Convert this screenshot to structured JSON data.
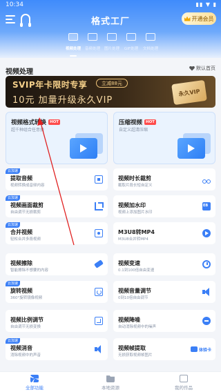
{
  "status": {
    "time": "10:34",
    "sys": "▮▮ ▼ ▮"
  },
  "header": {
    "title": "格式工厂",
    "vip_label": "开通会员"
  },
  "categories": [
    {
      "label": "视频处理",
      "active": true
    },
    {
      "label": "音频处理",
      "active": false
    },
    {
      "label": "图片处理",
      "active": false
    },
    {
      "label": "GIF处理",
      "active": false
    },
    {
      "label": "文档处理",
      "active": false
    }
  ],
  "section": {
    "title": "视频处理",
    "pin_label": "默认首页"
  },
  "banner": {
    "line1": "SVIP年卡限时专享",
    "button": "立减88元",
    "line2": "10元 加量升级永久VIP",
    "badge": "永久VIP"
  },
  "big_cards": [
    {
      "title": "视频格式转换",
      "hot": "HOT",
      "desc": "超千种组合任意换"
    },
    {
      "title": "压缩视频",
      "hot": "HOT",
      "desc": "自定义超清压缩"
    }
  ],
  "tag_label": "云加速",
  "items": [
    {
      "title": "提取音频",
      "desc": "视频转换成音频内容",
      "tag": true,
      "icon": "document-icon"
    },
    {
      "title": "视频时长裁剪",
      "desc": "截取片段长短自定义",
      "tag": false,
      "icon": "scissors-icon"
    },
    {
      "title": "视频画面裁剪",
      "desc": "自由调节无损裁剪",
      "tag": true,
      "icon": "crop-icon"
    },
    {
      "title": "视频加水印",
      "desc": "视频上添加图片水印",
      "tag": false,
      "icon": "watermark-icon"
    },
    {
      "title": "合并视频",
      "desc": "轻松合并多段视频",
      "tag": true,
      "icon": "merge-icon"
    },
    {
      "title": "M3U8转MP4",
      "desc": "M3U8合并转MP4",
      "tag": false,
      "icon": "play-icon"
    },
    {
      "title": "视频擦除",
      "desc": "智能擦除不想要的内容",
      "tag": false,
      "icon": "eraser-icon"
    },
    {
      "title": "视频变速",
      "desc": "0.1到100倍自由变速",
      "tag": false,
      "icon": "speed-icon"
    },
    {
      "title": "旋转视频",
      "desc": "360°旋转镜像视频",
      "tag": true,
      "icon": "rotate-icon"
    },
    {
      "title": "视频音量调节",
      "desc": "0到10倍自由调节",
      "tag": false,
      "icon": "volume-icon"
    },
    {
      "title": "视频比例调节",
      "desc": "自由调节无损变换",
      "tag": false,
      "icon": "ratio-icon"
    },
    {
      "title": "视频降噪",
      "desc": "自动消除视频中的噪声",
      "tag": false,
      "icon": "denoise-icon"
    },
    {
      "title": "视频消音",
      "desc": "消除视频中的声音",
      "tag": true,
      "icon": "mute-icon"
    },
    {
      "title": "视频帧提取",
      "desc": "无损获取视频帧图片",
      "tag": false,
      "icon": "trial-card-icon",
      "trial_label": "体验卡"
    }
  ],
  "bottom_nav": [
    {
      "label": "全部功能",
      "active": true
    },
    {
      "label": "本地资源",
      "active": false
    },
    {
      "label": "我的作品",
      "active": false
    }
  ],
  "colors": {
    "accent": "#3b7ff6",
    "hot": "#ff4b4b",
    "arrow": "#e02020"
  }
}
